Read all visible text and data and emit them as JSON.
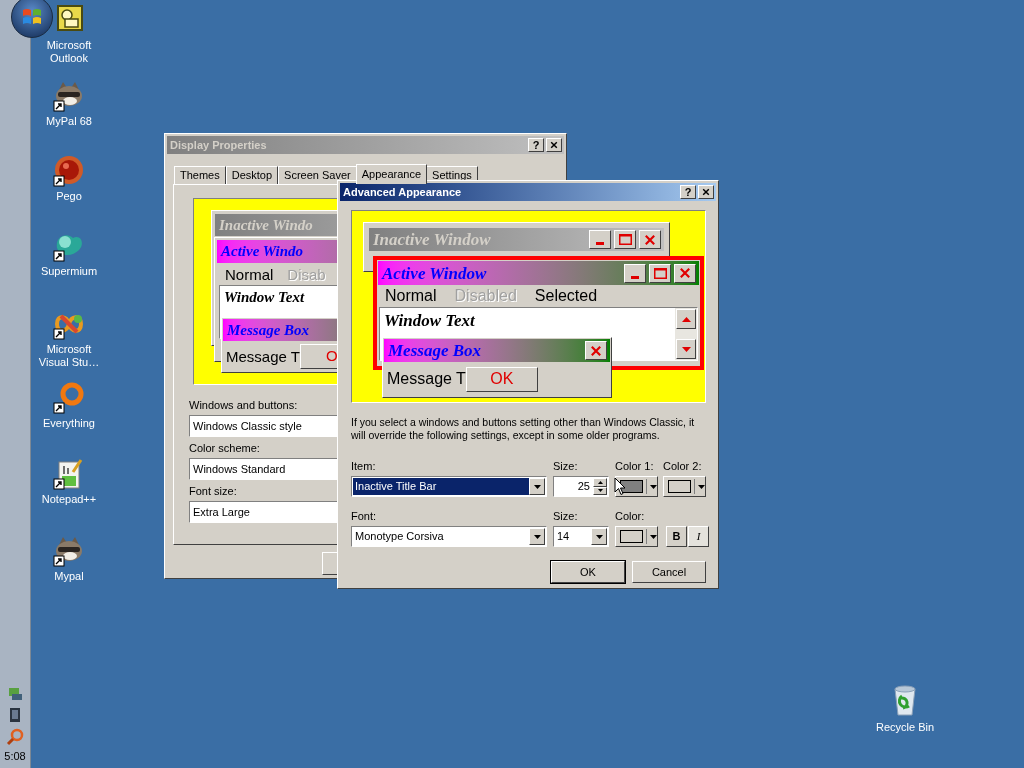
{
  "taskbar": {
    "clock": "5:08"
  },
  "desktop_icons": [
    {
      "label": "Microsoft Outlook",
      "kind": "outlook",
      "shortcut": false
    },
    {
      "label": "MyPal 68",
      "kind": "raccoon",
      "shortcut": true
    },
    {
      "label": "Pego",
      "kind": "pego",
      "shortcut": true
    },
    {
      "label": "Supermium",
      "kind": "supermium",
      "shortcut": true
    },
    {
      "label": "Microsoft Visual Stu…",
      "kind": "visual-studio",
      "shortcut": true
    },
    {
      "label": "Everything",
      "kind": "everything",
      "shortcut": true
    },
    {
      "label": "Notepad++",
      "kind": "notepad",
      "shortcut": true
    },
    {
      "label": "Mypal",
      "kind": "raccoon",
      "shortcut": true
    }
  ],
  "recycle_bin": {
    "label": "Recycle Bin"
  },
  "display_properties": {
    "title": "Display Properties",
    "help": "?",
    "tabs": [
      {
        "label": "Themes",
        "selected": false
      },
      {
        "label": "Desktop",
        "selected": false
      },
      {
        "label": "Screen Saver",
        "selected": false
      },
      {
        "label": "Appearance",
        "selected": true
      },
      {
        "label": "Settings",
        "selected": false
      }
    ],
    "preview": {
      "inactive_title": "Inactive Windo",
      "active_title": "Active Windo",
      "menu": [
        {
          "label": "Normal",
          "disabled": false
        },
        {
          "label": "Disab",
          "disabled": true
        }
      ],
      "window_text": "Window Text",
      "message_title": "Message Box",
      "message_text": "Message T",
      "ok": "O"
    },
    "fields": [
      {
        "label": "Windows and buttons:",
        "value": "Windows Classic style"
      },
      {
        "label": "Color scheme:",
        "value": "Windows Standard"
      },
      {
        "label": "Font size:",
        "value": "Extra Large"
      }
    ]
  },
  "advanced_appearance": {
    "title": "Advanced Appearance",
    "help": "?",
    "preview": {
      "inactive_title": "Inactive Window",
      "active_title": "Active Window",
      "menu": [
        {
          "label": "Normal",
          "disabled": false
        },
        {
          "label": "Disabled",
          "disabled": true
        },
        {
          "label": "Selected",
          "disabled": false
        }
      ],
      "window_text": "Window Text",
      "message_title": "Message Box",
      "message_text": "Message T",
      "ok": "OK"
    },
    "note": "If you select a windows and buttons setting other than Windows Classic, it will override the following settings, except in some older programs.",
    "item": {
      "label": "Item:",
      "value": "Inactive Title Bar"
    },
    "item_size": {
      "label": "Size:",
      "value": "25"
    },
    "color1": {
      "label": "Color 1:",
      "color": "#808080"
    },
    "color2": {
      "label": "Color 2:",
      "color": "#d4d0c8"
    },
    "font": {
      "label": "Font:",
      "value": "Monotype Corsiva"
    },
    "font_size": {
      "label": "Size:",
      "value": "14"
    },
    "font_color": {
      "label": "Color:",
      "color": "#d4d0c8"
    },
    "bold": "B",
    "italic": "I",
    "buttons": [
      {
        "label": "OK",
        "default": true
      },
      {
        "label": "Cancel",
        "default": false
      }
    ]
  }
}
